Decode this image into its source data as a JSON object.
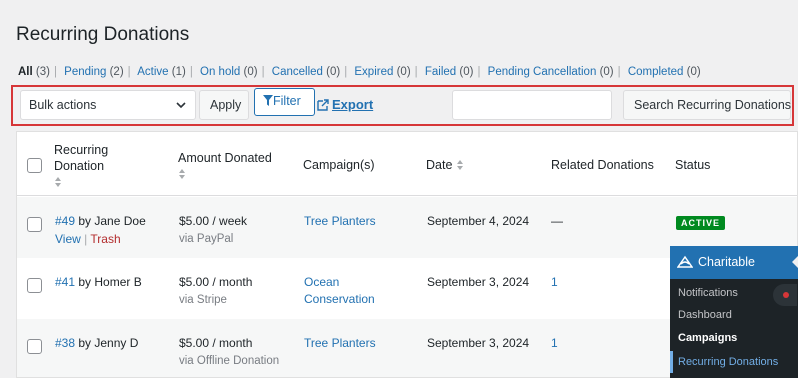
{
  "page": {
    "title": "Recurring Donations"
  },
  "filters": [
    {
      "label": "All",
      "count": "(3)",
      "current": true
    },
    {
      "label": "Pending",
      "count": "(2)"
    },
    {
      "label": "Active",
      "count": "(1)"
    },
    {
      "label": "On hold",
      "count": "(0)"
    },
    {
      "label": "Cancelled",
      "count": "(0)"
    },
    {
      "label": "Expired",
      "count": "(0)"
    },
    {
      "label": "Failed",
      "count": "(0)"
    },
    {
      "label": "Pending Cancellation",
      "count": "(0)"
    },
    {
      "label": "Completed",
      "count": "(0)"
    }
  ],
  "filter_separator": "|",
  "toolbar": {
    "bulk_actions": "Bulk actions",
    "apply_label": "Apply",
    "filter_label": "Filter",
    "export_label": "Export",
    "search_value": "",
    "search_button": "Search Recurring Donations"
  },
  "table": {
    "headers": {
      "donation_line1": "Recurring",
      "donation_line2": "Donation",
      "amount": "Amount Donated",
      "campaigns": "Campaign(s)",
      "date": "Date",
      "related": "Related Donations",
      "status": "Status"
    },
    "rows": [
      {
        "id": "#49",
        "donor": " by Jane Doe",
        "view": "View",
        "trash": "Trash",
        "sep": "|",
        "amount": "$5.00 / week",
        "via": "via PayPal",
        "campaign": [
          "Tree Planters"
        ],
        "date": "September 4, 2024",
        "related": "—",
        "status": "ACTIVE"
      },
      {
        "id": "#41",
        "donor": " by Homer B",
        "amount": "$5.00 / month",
        "via": "via Stripe",
        "campaign": [
          "Ocean",
          "Conservation"
        ],
        "date": "September 3, 2024",
        "related": "1",
        "status": ""
      },
      {
        "id": "#38",
        "donor": " by Jenny D",
        "amount": "$5.00 / month",
        "via": "via Offline Donation",
        "campaign": [
          "Tree Planters"
        ],
        "date": "September 3, 2024",
        "related": "1",
        "status": ""
      }
    ]
  },
  "admin_menu": {
    "title": "Charitable",
    "items": [
      "Notifications",
      "Dashboard",
      "Campaigns",
      "Recurring Donations"
    ],
    "active_color": "#72aee6",
    "menu_bg": "#1d2327",
    "head_bg": "#2271b1"
  },
  "colors": {
    "link": "#2271b1",
    "danger": "#d63638",
    "status_active": "#008a20"
  }
}
